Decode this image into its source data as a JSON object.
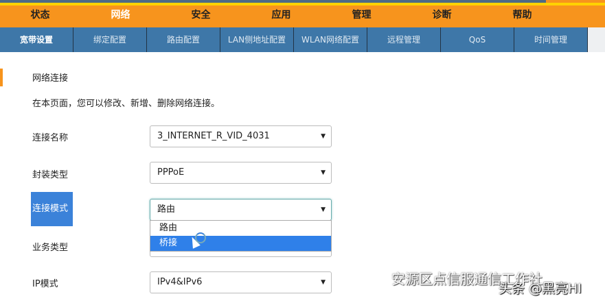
{
  "main_nav": [
    "状态",
    "网络",
    "安全",
    "应用",
    "管理",
    "诊断",
    "帮助"
  ],
  "sub_nav": [
    "宽带设置",
    "绑定配置",
    "路由配置",
    "LAN侧地址配置",
    "WLAN网络配置",
    "远程管理",
    "QoS",
    "时间管理"
  ],
  "content": {
    "section_title": "网络连接",
    "description": "在本页面，您可以修改、新增、删除网络连接。",
    "fields": [
      {
        "label": "连接名称",
        "value": "3_INTERNET_R_VID_4031"
      },
      {
        "label": "封装类型",
        "value": "PPPoE"
      },
      {
        "label": "连接模式",
        "value": "路由"
      },
      {
        "label": "业务类型",
        "value": ""
      },
      {
        "label": "IP模式",
        "value": "IPv4&IPv6"
      }
    ],
    "dropdown_options": [
      "路由",
      "桥接"
    ]
  },
  "watermark": {
    "line1": "安源区点信服通信工作社",
    "line2": "头条 @黑亮HI"
  },
  "colors": {
    "accent": "#f7941d",
    "subnav": "#3e77a8",
    "highlight": "#2f80e9"
  }
}
